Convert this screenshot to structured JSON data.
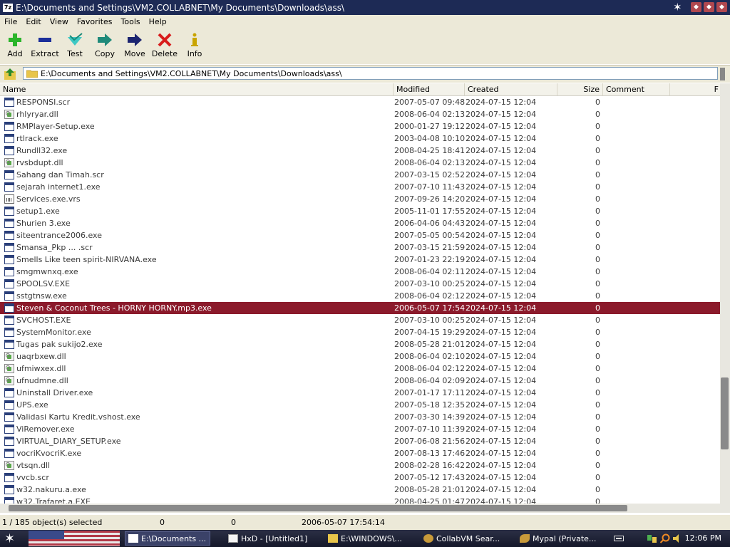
{
  "window": {
    "title": "E:\\Documents and Settings\\VM2.COLLABNET\\My Documents\\Downloads\\ass\\",
    "app_icon_text": "7z"
  },
  "menu": [
    "File",
    "Edit",
    "View",
    "Favorites",
    "Tools",
    "Help"
  ],
  "toolbar": {
    "add": "Add",
    "extract": "Extract",
    "test": "Test",
    "copy": "Copy",
    "move": "Move",
    "delete": "Delete",
    "info": "Info"
  },
  "address": {
    "path": "E:\\Documents and Settings\\VM2.COLLABNET\\My Documents\\Downloads\\ass\\"
  },
  "columns": {
    "name": "Name",
    "modified": "Modified",
    "created": "Created",
    "size": "Size",
    "comment": "Comment",
    "extra": "F"
  },
  "files": [
    {
      "name": "RESPONSI.scr",
      "modified": "2007-05-07 09:48",
      "created": "2024-07-15 12:04",
      "size": "0",
      "icon": "exe"
    },
    {
      "name": "rhlyryar.dll",
      "modified": "2008-06-04 02:13",
      "created": "2024-07-15 12:04",
      "size": "0",
      "icon": "dll"
    },
    {
      "name": "RMPlayer-Setup.exe",
      "modified": "2000-01-27 19:12",
      "created": "2024-07-15 12:04",
      "size": "0",
      "icon": "exe"
    },
    {
      "name": "rtlrack.exe",
      "modified": "2003-04-08 10:10",
      "created": "2024-07-15 12:04",
      "size": "0",
      "icon": "exe"
    },
    {
      "name": "Rundll32.exe",
      "modified": "2008-04-25 18:41",
      "created": "2024-07-15 12:04",
      "size": "0",
      "icon": "exe"
    },
    {
      "name": "rvsbdupt.dll",
      "modified": "2008-06-04 02:13",
      "created": "2024-07-15 12:04",
      "size": "0",
      "icon": "dll"
    },
    {
      "name": "Sahang dan Timah.scr",
      "modified": "2007-03-15 02:52",
      "created": "2024-07-15 12:04",
      "size": "0",
      "icon": "exe"
    },
    {
      "name": "sejarah internet1.exe",
      "modified": "2007-07-10 11:43",
      "created": "2024-07-15 12:04",
      "size": "0",
      "icon": "exe"
    },
    {
      "name": "Services.exe.vrs",
      "modified": "2007-09-26 14:20",
      "created": "2024-07-15 12:04",
      "size": "0",
      "icon": "vrs"
    },
    {
      "name": "setup1.exe",
      "modified": "2005-11-01 17:55",
      "created": "2024-07-15 12:04",
      "size": "0",
      "icon": "exe"
    },
    {
      "name": "Shurien 3.exe",
      "modified": "2006-04-06 04:43",
      "created": "2024-07-15 12:04",
      "size": "0",
      "icon": "exe"
    },
    {
      "name": "siteentrance2006.exe",
      "modified": "2007-05-05 00:54",
      "created": "2024-07-15 12:04",
      "size": "0",
      "icon": "exe"
    },
    {
      "name": "Smansa_Pkp ... .scr",
      "modified": "2007-03-15 21:59",
      "created": "2024-07-15 12:04",
      "size": "0",
      "icon": "exe"
    },
    {
      "name": "Smells Like teen spirit-NIRVANA.exe",
      "modified": "2007-01-23 22:19",
      "created": "2024-07-15 12:04",
      "size": "0",
      "icon": "exe"
    },
    {
      "name": "smgmwnxq.exe",
      "modified": "2008-06-04 02:11",
      "created": "2024-07-15 12:04",
      "size": "0",
      "icon": "exe"
    },
    {
      "name": "SPOOLSV.EXE",
      "modified": "2007-03-10 00:25",
      "created": "2024-07-15 12:04",
      "size": "0",
      "icon": "exe"
    },
    {
      "name": "sstgtnsw.exe",
      "modified": "2008-06-04 02:12",
      "created": "2024-07-15 12:04",
      "size": "0",
      "icon": "exe"
    },
    {
      "name": "Steven & Coconut Trees -  HORNY HORNY.mp3.exe",
      "modified": "2006-05-07 17:54",
      "created": "2024-07-15 12:04",
      "size": "0",
      "icon": "exe",
      "selected": true
    },
    {
      "name": "SVCHOST.EXE",
      "modified": "2007-03-10 00:25",
      "created": "2024-07-15 12:04",
      "size": "0",
      "icon": "exe"
    },
    {
      "name": "SystemMonitor.exe",
      "modified": "2007-04-15 19:29",
      "created": "2024-07-15 12:04",
      "size": "0",
      "icon": "exe"
    },
    {
      "name": "Tugas pak sukijo2.exe",
      "modified": "2008-05-28 21:01",
      "created": "2024-07-15 12:04",
      "size": "0",
      "icon": "exe"
    },
    {
      "name": "uaqrbxew.dll",
      "modified": "2008-06-04 02:10",
      "created": "2024-07-15 12:04",
      "size": "0",
      "icon": "dll"
    },
    {
      "name": "ufmiwxex.dll",
      "modified": "2008-06-04 02:12",
      "created": "2024-07-15 12:04",
      "size": "0",
      "icon": "dll"
    },
    {
      "name": "ufnudmne.dll",
      "modified": "2008-06-04 02:09",
      "created": "2024-07-15 12:04",
      "size": "0",
      "icon": "dll"
    },
    {
      "name": "Uninstall Driver.exe",
      "modified": "2007-01-17 17:11",
      "created": "2024-07-15 12:04",
      "size": "0",
      "icon": "exe"
    },
    {
      "name": "UPS.exe",
      "modified": "2007-05-18 12:35",
      "created": "2024-07-15 12:04",
      "size": "0",
      "icon": "exe"
    },
    {
      "name": "Validasi Kartu Kredit.vshost.exe",
      "modified": "2007-03-30 14:39",
      "created": "2024-07-15 12:04",
      "size": "0",
      "icon": "exe"
    },
    {
      "name": "ViRemover.exe",
      "modified": "2007-07-10 11:39",
      "created": "2024-07-15 12:04",
      "size": "0",
      "icon": "exe"
    },
    {
      "name": "VIRTUAL_DIARY_SETUP.exe",
      "modified": "2007-06-08 21:56",
      "created": "2024-07-15 12:04",
      "size": "0",
      "icon": "exe"
    },
    {
      "name": "vocriKvocriK.exe",
      "modified": "2007-08-13 17:46",
      "created": "2024-07-15 12:04",
      "size": "0",
      "icon": "exe"
    },
    {
      "name": "vtsqn.dll",
      "modified": "2008-02-28 16:42",
      "created": "2024-07-15 12:04",
      "size": "0",
      "icon": "dll"
    },
    {
      "name": "vvcb.scr",
      "modified": "2007-05-12 17:43",
      "created": "2024-07-15 12:04",
      "size": "0",
      "icon": "exe"
    },
    {
      "name": "w32.nakuru.a.exe",
      "modified": "2008-05-28 21:01",
      "created": "2024-07-15 12:04",
      "size": "0",
      "icon": "exe"
    },
    {
      "name": "w32.Trafaret.a.EXE",
      "modified": "2008-04-25 01:47",
      "created": "2024-07-15 12:04",
      "size": "0",
      "icon": "exe"
    }
  ],
  "status": {
    "selected": "1 / 185 object(s) selected",
    "size1": "0",
    "size2": "0",
    "datetime": "2006-05-07 17:54:14"
  },
  "taskbar": {
    "tasks": [
      {
        "label": "E:\\Documents ...",
        "icon": "7zip-icon"
      },
      {
        "label": "HxD - [Untitled1]",
        "icon": "hxd-icon"
      },
      {
        "label": "E:\\WINDOWS\\...",
        "icon": "folder-icon"
      },
      {
        "label": "CollabVM Sear...",
        "icon": "browser-icon"
      },
      {
        "label": "Mypal (Private...",
        "icon": "mypal-icon"
      }
    ],
    "clock": "12:06 PM"
  },
  "colors": {
    "selection": "#8b1a2b",
    "titlebar": "#1d2a55",
    "chrome": "#ece9d8"
  }
}
